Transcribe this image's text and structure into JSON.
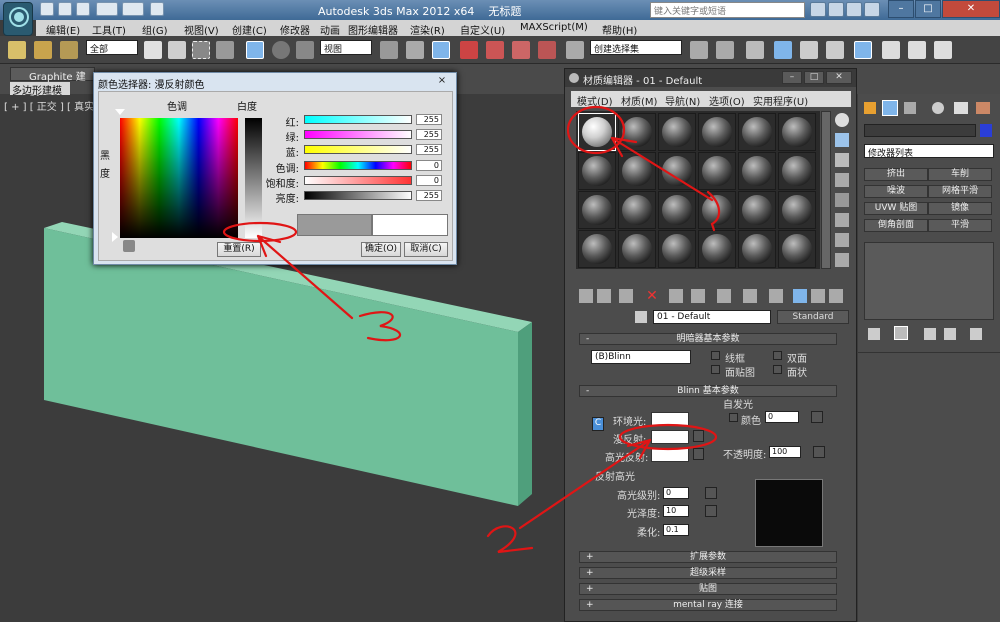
{
  "app": {
    "title": "Autodesk 3ds Max  2012 x64",
    "file": "无标题",
    "search_placeholder": "键入关键字或短语"
  },
  "menubar": [
    "编辑(E)",
    "工具(T)",
    "组(G)",
    "视图(V)",
    "创建(C)",
    "修改器",
    "动画",
    "图形编辑器",
    "渲染(R)",
    "自定义(U)",
    "MAXScript(M)",
    "帮助(H)"
  ],
  "toolbar": {
    "filter": "全部",
    "refcoord": "视图",
    "named_sel": "创建选择集"
  },
  "ribbon": {
    "tab": "Graphite 建模",
    "subtab": "多边形建模"
  },
  "viewport": {
    "label": "[ + ] [ 正交 ] [ 真实 ]"
  },
  "color_picker": {
    "title": "颜色选择器: 漫反射颜色",
    "close": "×",
    "hue_label": "色调",
    "white_label": "白度",
    "black_label": "黑\n度",
    "sliders": [
      {
        "label": "红:",
        "value": "255"
      },
      {
        "label": "绿:",
        "value": "255"
      },
      {
        "label": "蓝:",
        "value": "255"
      },
      {
        "label": "色调:",
        "value": "0"
      },
      {
        "label": "饱和度:",
        "value": "0"
      },
      {
        "label": "亮度:",
        "value": "255"
      }
    ],
    "reset": "重置(R)",
    "ok": "确定(O)",
    "cancel": "取消(C)"
  },
  "material_editor": {
    "title": "材质编辑器 - 01 - Default",
    "menus": [
      "模式(D)",
      "材质(M)",
      "导航(N)",
      "选项(O)",
      "实用程序(U)"
    ],
    "material_name": "01 - Default",
    "material_type": "Standard",
    "shader_rollout": "明暗器基本参数",
    "shader": "(B)Blinn",
    "checks": [
      "线框",
      "双面",
      "面贴图",
      "面状"
    ],
    "blinn_rollout": "Blinn 基本参数",
    "self_illum": "自发光",
    "color_chk": "颜色",
    "self_illum_value": "0",
    "ambient": "环境光:",
    "diffuse": "漫反射:",
    "specular": "高光反射:",
    "opacity_label": "不透明度:",
    "opacity": "100",
    "spec_highlights": "反射高光",
    "spec_level_label": "高光级别:",
    "spec_level": "0",
    "gloss_label": "光泽度:",
    "gloss": "10",
    "soften_label": "柔化:",
    "soften": "0.1",
    "rollouts": [
      "扩展参数",
      "超级采样",
      "贴图",
      "mental ray 连接"
    ],
    "lock": "C"
  },
  "command_panel": {
    "modifier_list": "修改器列表",
    "buttons": [
      "挤出",
      "车削",
      "噪波",
      "网格平滑",
      "UVW 贴图",
      "镜像",
      "倒角剖面",
      "平滑"
    ]
  },
  "annotations": [
    "1",
    "2",
    "3"
  ],
  "colors": {
    "accent": "#3f6a96",
    "annotation": "#e01515",
    "box": "#6fbf9a"
  }
}
